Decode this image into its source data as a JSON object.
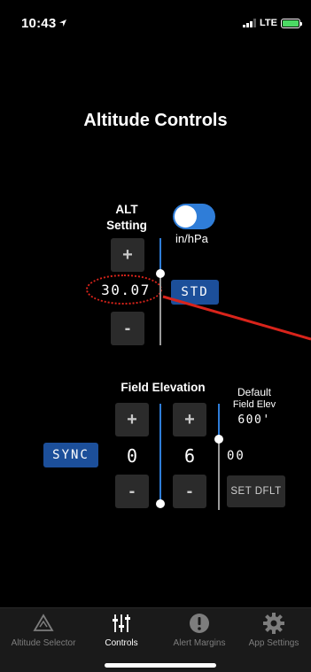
{
  "status": {
    "time": "10:43",
    "network": "LTE"
  },
  "title": "Altitude Controls",
  "alt": {
    "label_line1": "ALT",
    "label_line2": "Setting",
    "plus": "+",
    "minus": "-",
    "value": "30.07",
    "std_label": "STD",
    "unit_toggle_label": "in/hPa",
    "unit_toggle_on": true
  },
  "field_elevation": {
    "label": "Field Elevation",
    "sync_label": "SYNC",
    "plus": "+",
    "minus": "-",
    "thousands_digit": "0",
    "hundreds_digit": "6",
    "tens_ones": "00",
    "default_label_line1": "Default",
    "default_label_line2": "Field Elev",
    "default_value": "600'",
    "set_default_label": "SET DFLT"
  },
  "tabs": [
    {
      "label": "Altitude Selector",
      "icon": "altitude-selector-icon",
      "active": false
    },
    {
      "label": "Controls",
      "icon": "sliders-icon",
      "active": true
    },
    {
      "label": "Alert Margins",
      "icon": "alert-icon",
      "active": false
    },
    {
      "label": "App Settings",
      "icon": "gear-icon",
      "active": false
    }
  ],
  "colors": {
    "accent_blue": "#2f7dd8",
    "button_blue": "#1c4f9a",
    "annotation_red": "#d9241b"
  }
}
